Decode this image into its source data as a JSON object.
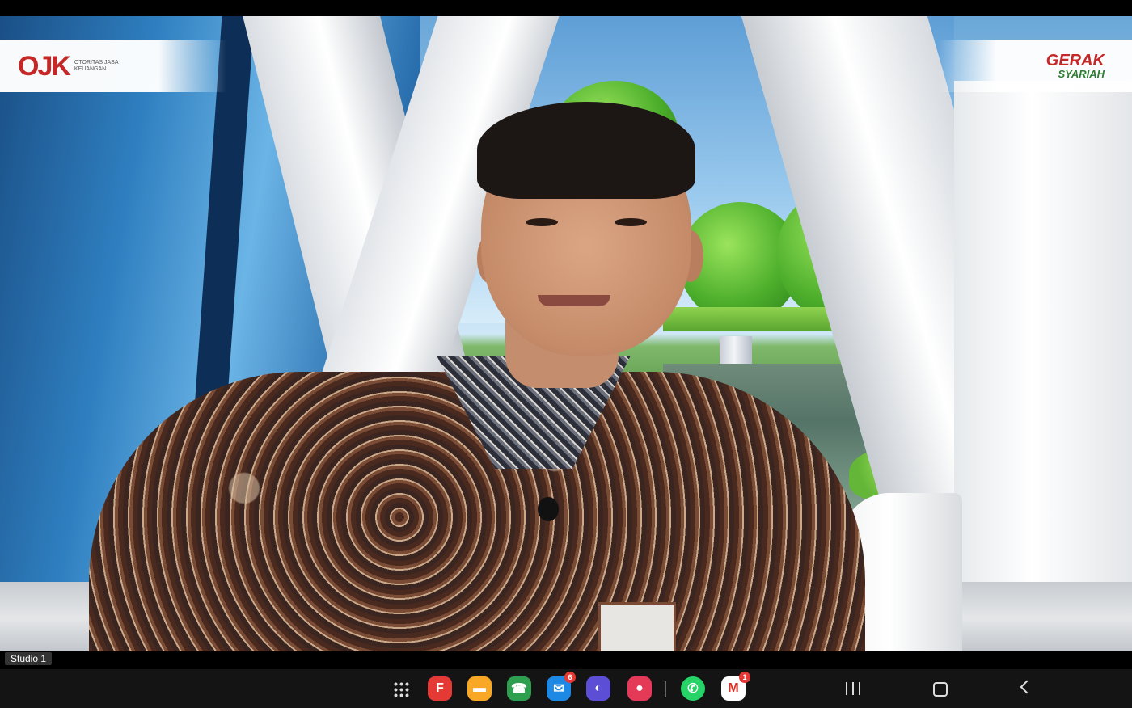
{
  "overlay": {
    "left_logo_text": "OJK",
    "left_logo_subtitle": "OTORITAS JASA KEUANGAN",
    "right_logo_line1": "GERAK",
    "right_logo_line2": "SYARIAH"
  },
  "video": {
    "participant_label": "Studio 1"
  },
  "taskbar": {
    "apps": [
      {
        "name": "app-drawer",
        "glyph": ""
      },
      {
        "name": "flipboard",
        "glyph": "F",
        "color": "#e53935"
      },
      {
        "name": "my-files",
        "glyph": "▬",
        "color": "#f9a825"
      },
      {
        "name": "phone",
        "glyph": "☎",
        "color": "#2e9e4f"
      },
      {
        "name": "messages",
        "glyph": "✉",
        "color": "#1e88e5",
        "badge": "6"
      },
      {
        "name": "samsung-internet",
        "glyph": "◐",
        "color": "#5c4fd6"
      },
      {
        "name": "screen-recorder",
        "glyph": "●",
        "color": "#e53958"
      },
      {
        "name": "whatsapp",
        "glyph": "✆",
        "color": "#25d366"
      },
      {
        "name": "gmail",
        "glyph": "M",
        "color": "#ffffff",
        "badge": "1"
      }
    ]
  }
}
